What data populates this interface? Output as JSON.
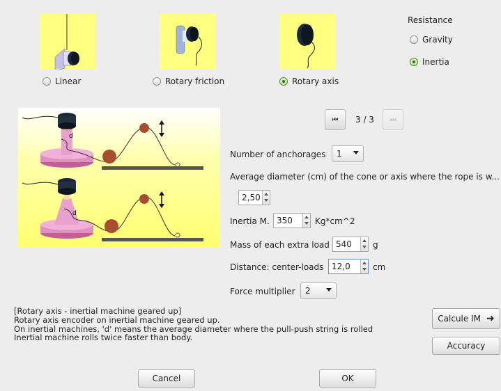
{
  "machine_types": [
    {
      "label": "Linear",
      "selected": false
    },
    {
      "label": "Rotary friction",
      "selected": false
    },
    {
      "label": "Rotary axis",
      "selected": true
    }
  ],
  "resistance": {
    "title": "Resistance",
    "options": [
      {
        "label": "Gravity",
        "selected": false
      },
      {
        "label": "Inertia",
        "selected": true
      }
    ]
  },
  "pager": {
    "text": "3 / 3"
  },
  "form": {
    "anchorages": {
      "label": "Number of anchorages",
      "value": "1"
    },
    "diameter": {
      "label": "Average diameter (cm) of the cone or axis where the rope is w...",
      "value": "2,50"
    },
    "inertia": {
      "label": "Inertia M.",
      "value": "350",
      "unit": "Kg*cm^2"
    },
    "mass": {
      "label": "Mass of each extra load",
      "value": "540",
      "unit": "g"
    },
    "distance": {
      "label": "Distance: center-loads",
      "value": "12,0",
      "unit": "cm"
    },
    "multiplier": {
      "label": "Force multiplier",
      "value": "2"
    }
  },
  "diagram": {
    "label_d": "d"
  },
  "description": [
    "[Rotary axis - inertial machine geared up]",
    "Rotary axis encoder on inertial machine geared up.",
    "On inertial machines, 'd' means the average diameter where the pull-push string is rolled",
    "Inertial machine rolls twice faster than body."
  ],
  "buttons": {
    "calcule": "Calcule IM",
    "accuracy": "Accuracy",
    "cancel": "Cancel",
    "ok": "OK"
  },
  "colors": {
    "thumb_bg": "#ffff80",
    "selected_radio": "#2e6e14"
  }
}
